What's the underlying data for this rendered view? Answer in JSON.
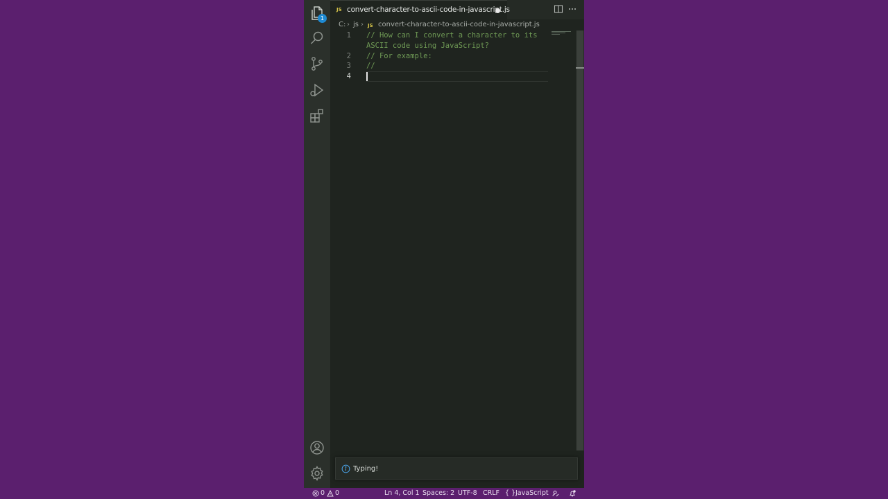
{
  "tab": {
    "file_icon": "JS",
    "filename": "convert-character-to-ascii-code-in-javascript.js"
  },
  "activity": {
    "explorer_badge": "1"
  },
  "breadcrumb": {
    "drive": "C:",
    "folder": "js",
    "file_icon": "JS",
    "file": "convert-character-to-ascii-code-in-javascript.js"
  },
  "editor": {
    "lines": [
      {
        "num": "1",
        "text": "// How can I convert a character to its"
      },
      {
        "num": "",
        "text": "ASCII code using JavaScript?"
      },
      {
        "num": "2",
        "text": "// For example:"
      },
      {
        "num": "3",
        "text": "//"
      },
      {
        "num": "4",
        "text": ""
      }
    ]
  },
  "notification": {
    "icon": "info-icon",
    "message": "Typing!"
  },
  "status": {
    "errors": "0",
    "warnings": "0",
    "position": "Ln 4, Col 1",
    "spaces": "Spaces: 2",
    "encoding": "UTF-8",
    "eol": "CRLF",
    "language": "JavaScript"
  },
  "colors": {
    "background": "#5b1f6e",
    "editor_bg": "#1f241f",
    "comment": "#6f9a55",
    "accent": "#1f8ad2"
  }
}
